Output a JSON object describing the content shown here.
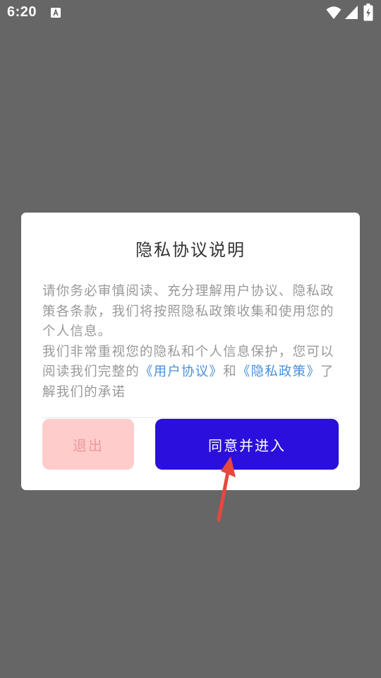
{
  "status_bar": {
    "time": "6:20"
  },
  "dialog": {
    "title": "隐私协议说明",
    "paragraph1": "请你务必审慎阅读、充分理解用户协议、隐私政策各条款，我们将按照隐私政策收集和使用您的个人信息。",
    "paragraph2_prefix": "我们非常重视您的隐私和个人信息保护，您可以阅读我们完整的",
    "user_agreement_link": "《用户协议》",
    "and_text": "和",
    "privacy_policy_link": "《隐私政策》",
    "paragraph2_suffix": "了解我们的承诺",
    "exit_label": "退出",
    "agree_label": "同意并进入"
  },
  "colors": {
    "overlay": "#666666",
    "link": "#4a90d9",
    "exit_bg": "#ffcccc",
    "agree_bg": "#2a0fdd",
    "arrow": "#e8473c"
  },
  "icons": [
    "notification-a-icon",
    "wifi-icon",
    "signal-icon",
    "battery-charging-icon",
    "red-arrow-pointer"
  ]
}
